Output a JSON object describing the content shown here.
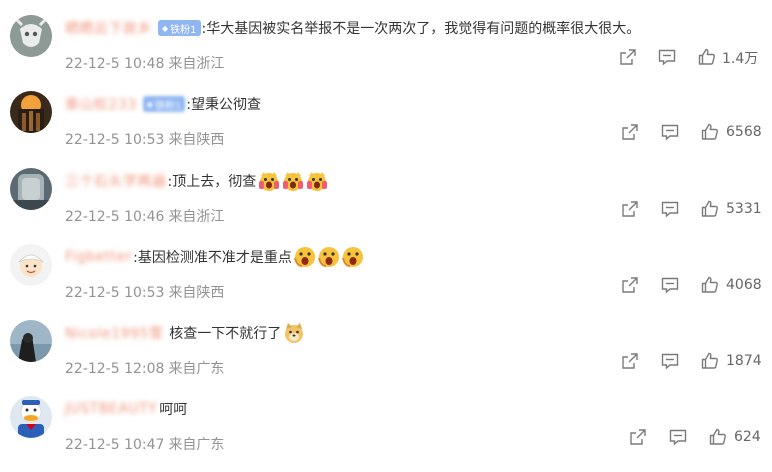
{
  "comments": [
    {
      "username": "晒晒云下故乡",
      "badge": "铁粉1",
      "badge_blurred": false,
      "text": ":华大基因被实名举报不是一次两次了，我觉得有问题的概率很大很大。",
      "emojis": [],
      "time": "22-12-5 10:48",
      "location": "来自浙江",
      "likes": "1.4万"
    },
    {
      "username": "泰山松233",
      "badge": "铁粉1",
      "badge_blurred": true,
      "text": ":望秉公彻查",
      "emojis": [],
      "time": "22-12-5 10:53",
      "location": "来自陕西",
      "likes": "6568"
    },
    {
      "username": "三个石头学两遍",
      "badge": "",
      "badge_blurred": false,
      "text": ":顶上去，彻查",
      "emojis": [
        "scream-cat-emoji",
        "scream-cat-emoji",
        "scream-cat-emoji"
      ],
      "time": "22-12-5 10:46",
      "location": "来自浙江",
      "likes": "5331"
    },
    {
      "username": "Figbetter",
      "badge": "",
      "badge_blurred": false,
      "text": ":基因检测准不准才是重点",
      "emojis": [
        "shocked-emoji",
        "shocked-emoji",
        "shocked-emoji"
      ],
      "time": "22-12-5 10:53",
      "location": "来自陕西",
      "likes": "4068"
    },
    {
      "username": "Nicole1995雪",
      "badge": "",
      "badge_blurred": false,
      "text": "核查一下不就行了",
      "emojis": [
        "doge-emoji"
      ],
      "time": "22-12-5 12:08",
      "location": "来自广东",
      "likes": "1874"
    },
    {
      "username": "JUSTBEAUTY",
      "badge": "",
      "badge_blurred": false,
      "text": "呵呵",
      "emojis": [],
      "time": "22-12-5 10:47",
      "location": "来自广东",
      "likes": "624"
    }
  ],
  "icons": {
    "share": "share-icon",
    "comment": "comment-icon",
    "like": "like-icon"
  },
  "colors": {
    "username": "#eb7350",
    "badge": "#8fb6f2",
    "meta": "#939393",
    "icon": "#7a7a7a"
  }
}
